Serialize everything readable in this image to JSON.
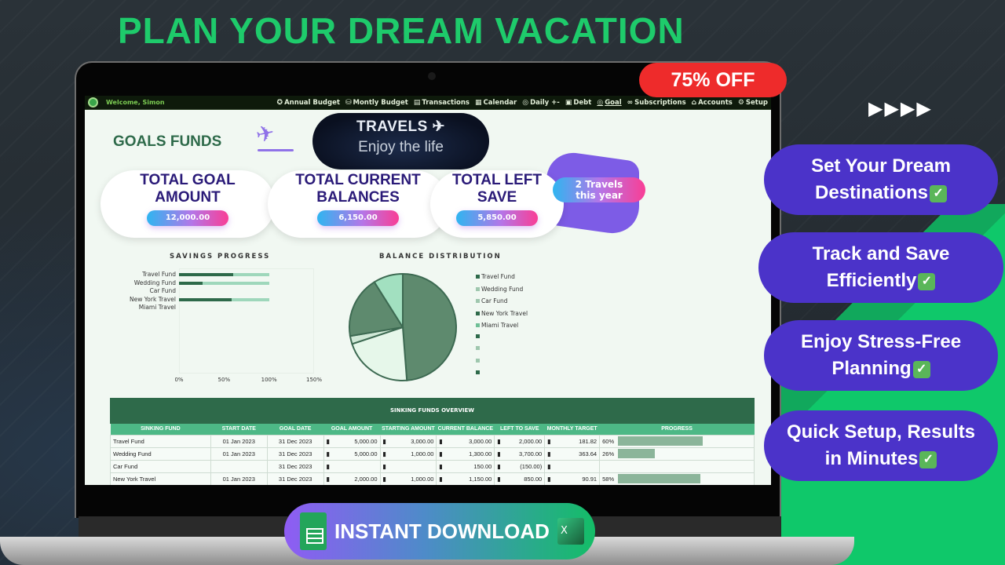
{
  "headline": "PLAN YOUR DREAM VACATION",
  "offer_badge": "75% OFF",
  "nav": {
    "welcome": "Welcome, Simon",
    "items": [
      {
        "label": "Annual Budget",
        "icon": "✪"
      },
      {
        "label": "Montly Budget",
        "icon": "⛁"
      },
      {
        "label": "Transactions",
        "icon": "▤"
      },
      {
        "label": "Calendar",
        "icon": "▦"
      },
      {
        "label": "Daily +-",
        "icon": "◎"
      },
      {
        "label": "Debt",
        "icon": "▣"
      },
      {
        "label": "Goal",
        "icon": "◎",
        "active": true
      },
      {
        "label": "Subscriptions",
        "icon": "∞"
      },
      {
        "label": "Accounts",
        "icon": "⌂"
      },
      {
        "label": "Setup",
        "icon": "⚙"
      }
    ]
  },
  "dashboard": {
    "title": "GOALS FUNDS",
    "banner_title": "TRAVELS ✈",
    "banner_sub": "Enjoy the life",
    "kpis": [
      {
        "label_line1": "TOTAL GOAL",
        "label_line2": "AMOUNT",
        "value": "12,000.00"
      },
      {
        "label_line1": "TOTAL CURRENT",
        "label_line2": "BALANCES",
        "value": "6,150.00"
      },
      {
        "label_line1": "TOTAL LEFT",
        "label_line2": "SAVE",
        "value": "5,850.00"
      }
    ],
    "ribbon_line1": "2 Travels",
    "ribbon_line2": "this year"
  },
  "chart_data": [
    {
      "type": "bar",
      "title": "SAVINGS PROGRESS",
      "orientation": "horizontal",
      "categories": [
        "Travel Fund",
        "Wedding Fund",
        "Car Fund",
        "New York Travel",
        "Miami Travel"
      ],
      "series": [
        {
          "name": "Progress",
          "values": [
            60,
            26,
            0,
            58,
            0
          ],
          "color": "#2e6a4a"
        },
        {
          "name": "Target",
          "values": [
            100,
            100,
            0,
            100,
            0
          ],
          "color": "#9ed7bb"
        }
      ],
      "xticks": [
        "0%",
        "50%",
        "100%",
        "150%"
      ],
      "xlim": [
        0,
        150
      ]
    },
    {
      "type": "pie",
      "title": "BALANCE DISTRIBUTION",
      "labels": [
        "Travel Fund",
        "Wedding Fund",
        "Car Fund",
        "New York Travel",
        "Miami Travel"
      ],
      "values": [
        3000,
        1300,
        150,
        1150,
        550
      ],
      "colors": [
        "#5e8a6e",
        "#e6f7ea",
        "#cfe8d6",
        "#5e8a6e",
        "#a2e0c0"
      ],
      "legend_position": "right",
      "extra_legend_swatches": 4
    }
  ],
  "table": {
    "title": "SINKING FUNDS OVERVIEW",
    "columns": [
      "SINKING FUND",
      "START DATE",
      "GOAL DATE",
      "GOAL AMOUNT",
      "STARTING AMOUNT",
      "CURRENT BALANCE",
      "LEFT TO SAVE",
      "MONTHLY TARGET",
      "PROGRESS"
    ],
    "rows": [
      {
        "fund": "Travel Fund",
        "start": "01 Jan 2023",
        "goal_date": "31 Dec 2023",
        "goal": "5,000.00",
        "starting": "3,000.00",
        "current": "3,000.00",
        "left": "2,000.00",
        "monthly": "181.82",
        "pct_label": "60%",
        "pct": 60
      },
      {
        "fund": "Wedding Fund",
        "start": "01 Jan 2023",
        "goal_date": "31 Dec 2023",
        "goal": "5,000.00",
        "starting": "1,000.00",
        "current": "1,300.00",
        "left": "3,700.00",
        "monthly": "363.64",
        "pct_label": "26%",
        "pct": 26
      },
      {
        "fund": "Car Fund",
        "start": "",
        "goal_date": "31 Dec 2023",
        "goal": "",
        "starting": "",
        "current": "150.00",
        "left": "(150.00)",
        "monthly": "",
        "pct_label": "",
        "pct": 0
      },
      {
        "fund": "New York Travel",
        "start": "01 Jan 2023",
        "goal_date": "31 Dec 2023",
        "goal": "2,000.00",
        "starting": "1,000.00",
        "current": "1,150.00",
        "left": "850.00",
        "monthly": "90.91",
        "pct_label": "58%",
        "pct": 58
      }
    ],
    "currency_symbol": "▮"
  },
  "features": {
    "arrows": "▶▶▶▶",
    "items": [
      {
        "line1": "Set Your Dream",
        "line2": "Destinations",
        "check": "✓"
      },
      {
        "line1": "Track and Save",
        "line2": "Efficiently",
        "check": "✓"
      },
      {
        "line1": "Enjoy Stress-Free",
        "line2": "Planning",
        "check": "✓"
      },
      {
        "line1": "Quick Setup, Results",
        "line2": "in Minutes",
        "check": "✓"
      }
    ]
  },
  "download": {
    "label": "INSTANT DOWNLOAD",
    "excel_letter": "X"
  }
}
